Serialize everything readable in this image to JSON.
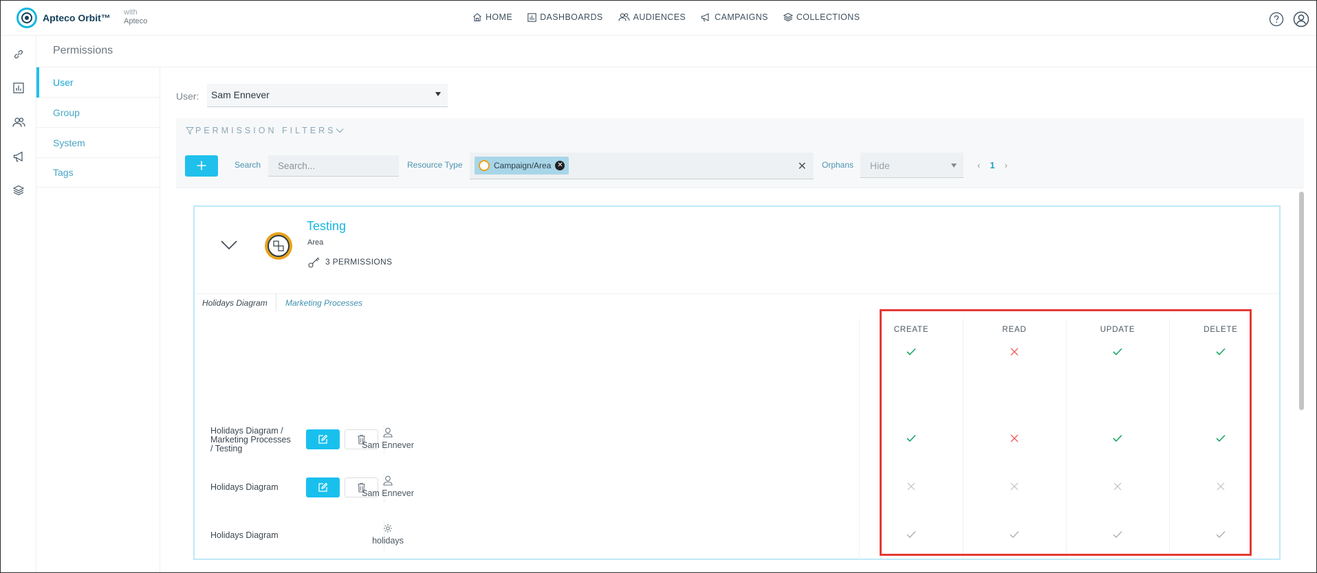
{
  "app": {
    "name": "Apteco Orbit™",
    "with_label": "with",
    "with_brand": "Apteco"
  },
  "nav": [
    {
      "label": "HOME",
      "icon": "home-icon"
    },
    {
      "label": "DASHBOARDS",
      "icon": "bar-chart-icon"
    },
    {
      "label": "AUDIENCES",
      "icon": "people-icon"
    },
    {
      "label": "CAMPAIGNS",
      "icon": "megaphone-icon"
    },
    {
      "label": "COLLECTIONS",
      "icon": "layers-icon"
    }
  ],
  "page": {
    "title": "Permissions"
  },
  "submenu": [
    {
      "label": "User",
      "active": true
    },
    {
      "label": "Group",
      "active": false
    },
    {
      "label": "System",
      "active": false
    },
    {
      "label": "Tags",
      "active": false
    }
  ],
  "user_select": {
    "label": "User:",
    "value": "Sam Ennever"
  },
  "filters": {
    "title": "PERMISSION FILTERS",
    "search_label": "Search",
    "search_placeholder": "Search...",
    "resource_label": "Resource Type",
    "resource_chip": "Campaign/Area",
    "orphans_label": "Orphans",
    "orphans_value": "Hide",
    "page": "1"
  },
  "card": {
    "title": "Testing",
    "type": "Area",
    "permissions_count": "3 PERMISSIONS",
    "crumbs": [
      "Holidays Diagram",
      "Marketing Processes"
    ],
    "columns": [
      "CREATE",
      "READ",
      "UPDATE",
      "DELETE"
    ],
    "summary": [
      "allowed",
      "denied",
      "allowed",
      "allowed"
    ],
    "rows": [
      {
        "path": [
          "Holidays Diagram /",
          "Marketing Processes",
          "/ Testing"
        ],
        "editable": true,
        "owner": "Sam Ennever",
        "owner_icon": "user-icon",
        "perms": [
          "allowed",
          "denied",
          "allowed",
          "allowed"
        ]
      },
      {
        "path": [
          "Holidays Diagram"
        ],
        "editable": true,
        "owner": "Sam Ennever",
        "owner_icon": "user-icon",
        "perms": [
          "unset",
          "unset",
          "unset",
          "unset"
        ]
      },
      {
        "path": [
          "Holidays Diagram"
        ],
        "editable": false,
        "owner": "holidays",
        "owner_icon": "gear-icon",
        "perms": [
          "inherited",
          "inherited",
          "inherited",
          "inherited"
        ]
      }
    ]
  },
  "colors": {
    "accent": "#20c0ec",
    "allowed": "#1aa868",
    "denied": "#ec5a5a",
    "unset": "#b9bfc3",
    "inherited": "#9aa3a8",
    "highlight": "#e53935"
  }
}
